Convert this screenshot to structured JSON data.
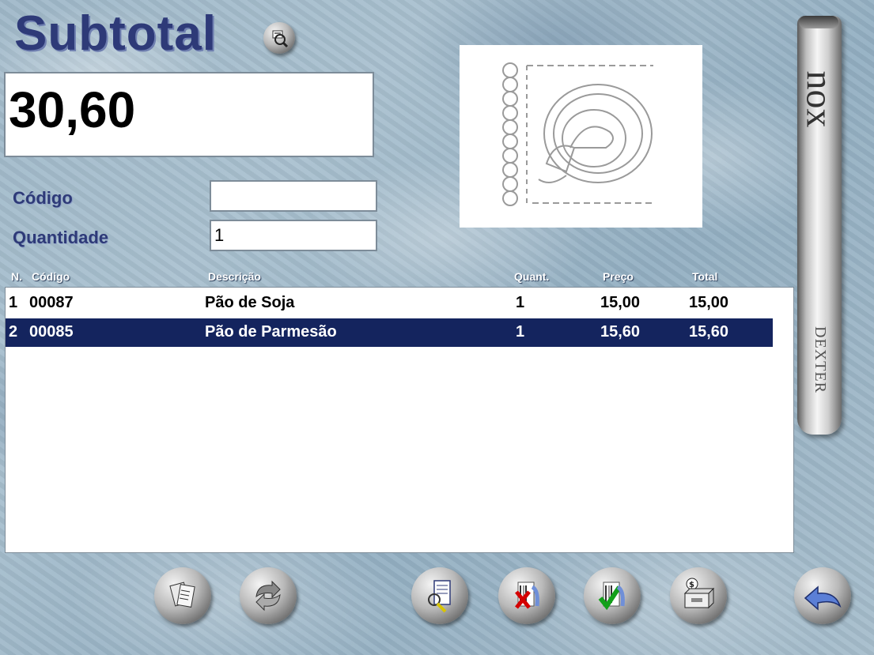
{
  "header": {
    "title": "Subtotal",
    "search_icon": "zoom-icon"
  },
  "total": {
    "value": "30,60"
  },
  "form": {
    "codigo_label": "Código",
    "codigo_value": "",
    "quantidade_label": "Quantidade",
    "quantidade_value": "1"
  },
  "brand": {
    "side_logo": "nox",
    "side_product": "DEXTER"
  },
  "table": {
    "headers": [
      "N.",
      "Código",
      "Descrição",
      "Quant.",
      "Preço",
      "Total"
    ],
    "rows": [
      {
        "n": "1",
        "codigo": "00087",
        "descricao": "Pão de Soja",
        "quant": "1",
        "preco": "15,00",
        "total": "15,00",
        "selected": false
      },
      {
        "n": "2",
        "codigo": "00085",
        "descricao": "Pão de Parmesão",
        "quant": "1",
        "preco": "15,60",
        "total": "15,60",
        "selected": true
      }
    ]
  },
  "toolbar": {
    "buttons": [
      {
        "icon": "documents-icon"
      },
      {
        "icon": "refresh-icon"
      },
      {
        "icon": "search-receipt-icon"
      },
      {
        "icon": "cancel-item-icon"
      },
      {
        "icon": "confirm-icon"
      },
      {
        "icon": "cash-register-icon"
      },
      {
        "icon": "back-arrow-icon"
      }
    ]
  },
  "colors": {
    "title": "#2e3a78",
    "selected_row": "#14245e",
    "background": "#a6bdcc"
  }
}
